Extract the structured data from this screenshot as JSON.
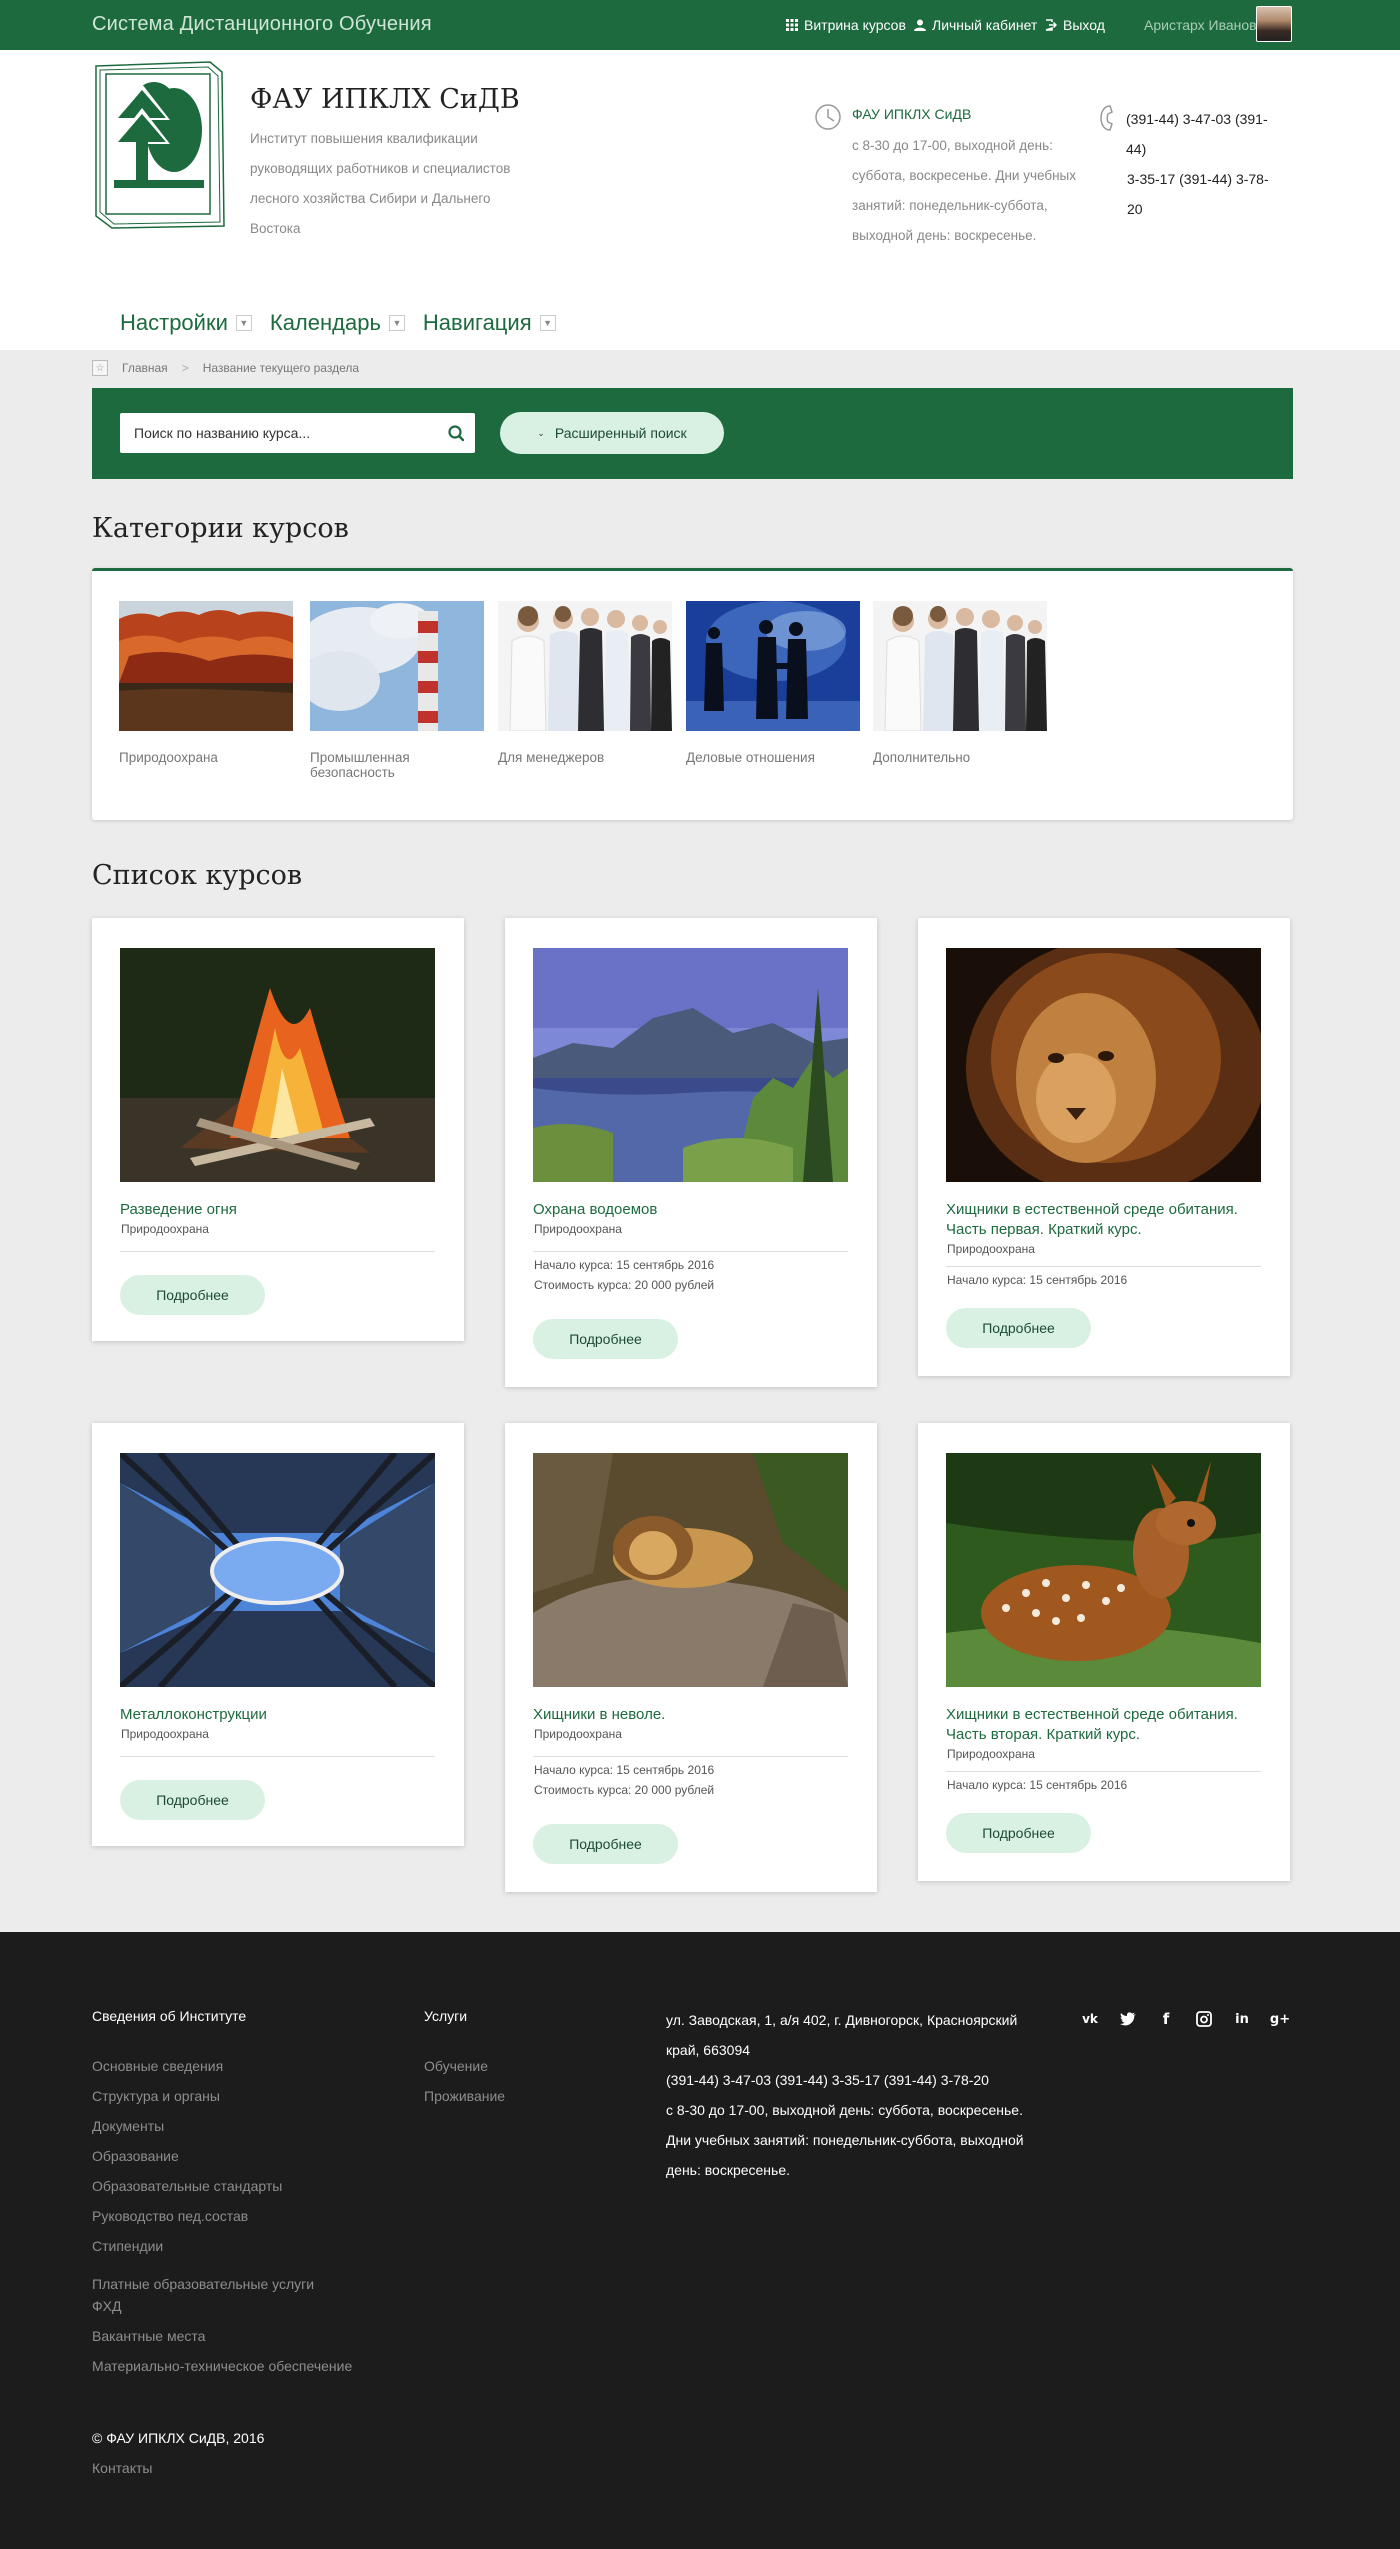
{
  "topbar": {
    "site_title": "Система Дистанционного Обучения",
    "showcase_label": "Витрина курсов",
    "cabinet_label": "Личный кабинет",
    "logout_label": "Выход",
    "user_name": "Аристарх Иванов"
  },
  "header": {
    "org_name": "ФАУ ИПКЛХ СиДВ",
    "org_desc": "Институт повышения квалификации руководящих работников и специалистов лесного хозяйства Сибири и Дальнего Востока",
    "hours_title": "ФАУ ИПКЛХ СиДВ",
    "hours_text": "с 8-30 до 17-00, выходной день: суббота, воскресенье. Дни учебных занятий: понедельник-суббота, выходной день: воскресенье.",
    "phone_1": "(391-44) 3-47-03 (391-44)",
    "phone_2": "3-35-17 (391-44) 3-78-20"
  },
  "nav": {
    "settings": "Настройки",
    "calendar": "Календарь",
    "navigation": "Навигация"
  },
  "breadcrumb": {
    "home": "Главная",
    "separator": ">",
    "current": "Название текущего раздела"
  },
  "search": {
    "placeholder": "Поиск по названию курса...",
    "advanced_label": "Расширенный поиск"
  },
  "categories": {
    "title": "Категории курсов",
    "items": [
      {
        "label": "Природоохрана"
      },
      {
        "label": "Промышленная безопасность"
      },
      {
        "label": "Для менеджеров"
      },
      {
        "label": "Деловые отношения"
      },
      {
        "label": "Дополнительно"
      }
    ]
  },
  "courses": {
    "title": "Список курсов",
    "more_label": "Подробнее",
    "items": [
      {
        "title": "Разведение огня",
        "category": "Природоохрана",
        "start": "",
        "price": ""
      },
      {
        "title": "Охрана водоемов",
        "category": "Природоохрана",
        "start": "Начало курса: 15 сентябрь 2016",
        "price": "Стоимость курса: 20 000 рублей"
      },
      {
        "title": "Хищники в естественной среде обитания. Часть первая. Краткий курс.",
        "category": "Природоохрана",
        "start": "Начало курса: 15 сентябрь 2016",
        "price": ""
      },
      {
        "title": "Металлоконструкции",
        "category": "Природоохрана",
        "start": "",
        "price": ""
      },
      {
        "title": "Хищники в неволе.",
        "category": "Природоохрана",
        "start": "Начало курса: 15 сентябрь 2016",
        "price": "Стоимость курса: 20 000 рублей"
      },
      {
        "title": "Хищники в естественной среде обитания. Часть вторая. Краткий курс.",
        "category": "Природоохрана",
        "start": "Начало курса: 15 сентябрь 2016",
        "price": ""
      }
    ]
  },
  "footer": {
    "about_title": "Сведения об Институте",
    "about_items": [
      "Основные сведения",
      "Структура и органы",
      "Документы",
      "Образование",
      "Образовательные стандарты",
      "Руководство пед.состав",
      "Стипендии",
      "Платные образовательные услуги",
      "ФХД",
      "Вакантные места",
      "Материально-техническое обеспечение"
    ],
    "services_title": "Услуги",
    "services_items": [
      "Обучение",
      "Проживание"
    ],
    "address": "ул. Заводская, 1, а/я 402, г. Дивногорск, Красноярский край, 663094",
    "phones": "(391-44) 3-47-03 (391-44) 3-35-17 (391-44) 3-78-20",
    "hours": "с 8-30 до 17-00, выходной день: суббота, воскресенье. Дни учебных занятий: понедельник-суббота, выходной день: воскресенье.",
    "copyright": "© ФАУ ИПКЛХ СиДВ, 2016",
    "contacts": "Контакты",
    "socials": [
      "vk-icon",
      "twitter-icon",
      "facebook-icon",
      "instagram-icon",
      "linkedin-icon",
      "google-plus-icon"
    ]
  },
  "colors": {
    "brand_green": "#1d6a3e",
    "button_mint": "#d9f1e2",
    "footer_bg": "#1c1c1c",
    "page_bg": "#ececec"
  }
}
